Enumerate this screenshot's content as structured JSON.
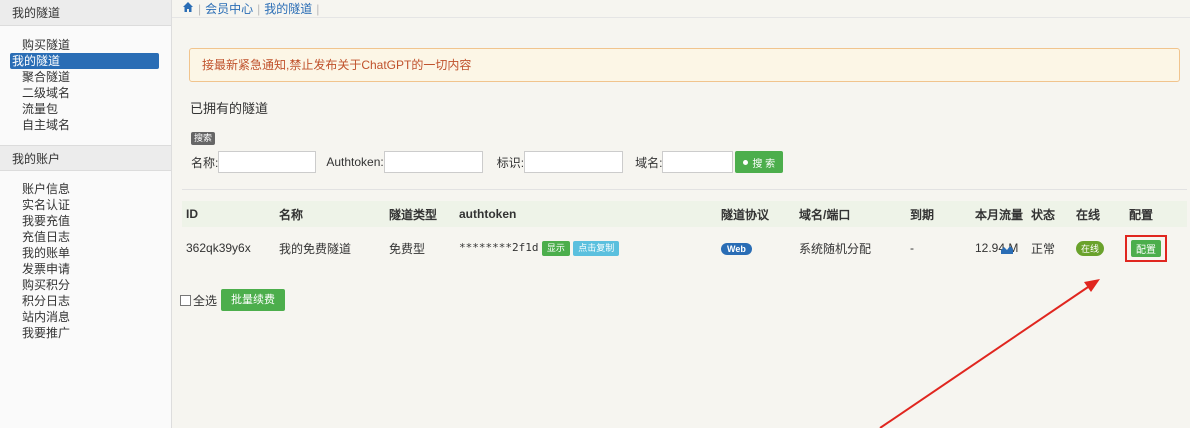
{
  "sidebar": {
    "tunnels_heading": "我的隧道",
    "tunnel_items": [
      {
        "label": "购买隧道",
        "active": false
      },
      {
        "label": "我的隧道",
        "active": true
      },
      {
        "label": "聚合隧道",
        "active": false
      },
      {
        "label": "二级域名",
        "active": false
      },
      {
        "label": "流量包",
        "active": false
      },
      {
        "label": "自主域名",
        "active": false
      }
    ],
    "account_heading": "我的账户",
    "account_items": [
      {
        "label": "账户信息"
      },
      {
        "label": "实名认证"
      },
      {
        "label": "我要充值"
      },
      {
        "label": "充值日志"
      },
      {
        "label": "我的账单"
      },
      {
        "label": "发票申请"
      },
      {
        "label": "购买积分"
      },
      {
        "label": "积分日志"
      },
      {
        "label": "站内消息"
      },
      {
        "label": "我要推广"
      }
    ]
  },
  "breadcrumb": {
    "items": [
      "会员中心",
      "我的隧道"
    ]
  },
  "notice": {
    "text": "接最新紧急通知,禁止发布关于ChatGPT的一切内容"
  },
  "main": {
    "section_title": "已拥有的隧道"
  },
  "search": {
    "tag": "搜索",
    "name_label": "名称:",
    "authtoken_label": "Authtoken:",
    "mark_label": "标识:",
    "domain_label": "域名:",
    "name_value": "",
    "authtoken_value": "",
    "mark_value": "",
    "domain_value": "",
    "button_label": "搜 索"
  },
  "table": {
    "headers": [
      "ID",
      "名称",
      "隧道类型",
      "authtoken",
      "隧道协议",
      "域名/端口",
      "到期",
      "本月流量",
      "状态",
      "在线",
      "配置"
    ],
    "rows": [
      {
        "id": "362qk39y6x",
        "name": "我的免费隧道",
        "type": "免费型",
        "authtoken": "********2f1d",
        "show_label": "显示",
        "copy_label": "点击复制",
        "protocol": "Web",
        "domain": "系统随机分配",
        "expiry": "-",
        "traffic": "12.94 M",
        "status": "正常",
        "online": "在线",
        "config_label": "配置"
      }
    ]
  },
  "footer": {
    "select_all_label": "全选",
    "renew_button": "批量续费"
  },
  "colors": {
    "accent_blue": "#2a6db5",
    "green": "#4cae4c",
    "annotation_red": "#e0261f"
  }
}
